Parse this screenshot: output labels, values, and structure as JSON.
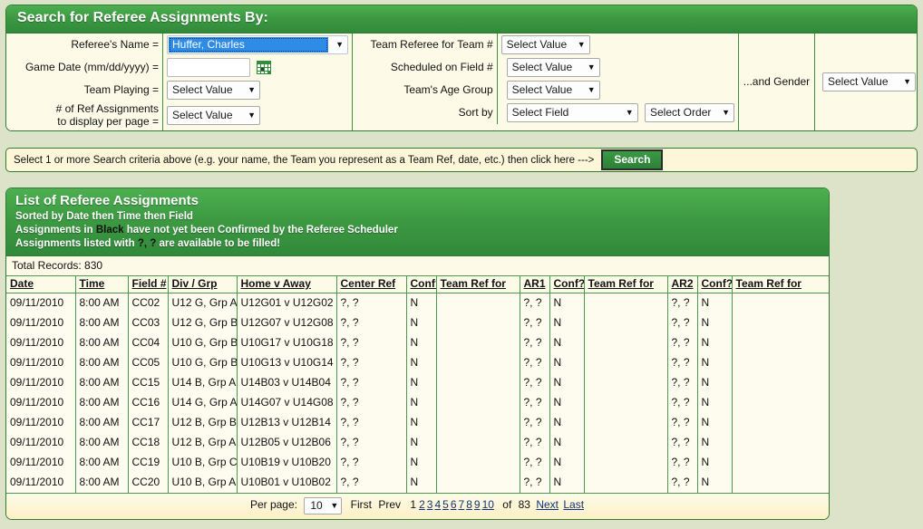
{
  "search_panel": {
    "title": "Search for Referee Assignments By:",
    "left_column": {
      "rows": [
        {
          "label": "Referee's Name =",
          "control": "select-name",
          "value": "Huffer, Charles"
        },
        {
          "label": "Game Date (mm/dd/yyyy) =",
          "control": "text-date",
          "value": "",
          "icon": "calendar-icon"
        },
        {
          "label": "Team Playing =",
          "control": "select",
          "value": "Select Value"
        },
        {
          "label": "# of Ref Assignments\nto display per page =",
          "label_line1": "# of Ref Assignments",
          "label_line2": "to display per page =",
          "control": "select",
          "value": "Select Value"
        }
      ]
    },
    "middle_column": {
      "rows": [
        {
          "label": "Team Referee for Team #",
          "control": "select",
          "value": "Select Value"
        },
        {
          "label": "Scheduled on Field #",
          "control": "select",
          "value": "Select Value"
        },
        {
          "label": "Team's Age Group",
          "control": "select",
          "value": "Select Value"
        },
        {
          "label": "Sort by",
          "control": "select2",
          "value": "Select Field",
          "value2": "Select Order"
        }
      ]
    },
    "gender_column": {
      "label": "...and Gender",
      "value": "Select Value"
    }
  },
  "hint_bar": {
    "text": "Select 1 or more Search criteria above (e.g. your name, the Team you represent as a Team Ref, date, etc.) then click here --->",
    "button": "Search"
  },
  "list_panel": {
    "title": "List of Referee Assignments",
    "sub1": "Sorted by Date then Time then Field",
    "sub2_a": "Assignments in ",
    "sub2_kw": "Black",
    "sub2_b": " have not yet been Confirmed by the Referee Scheduler",
    "sub3_a": "Assignments listed with ",
    "sub3_kw": "?, ?",
    "sub3_b": " are available to be filled!",
    "total_records": "Total Records: 830",
    "columns": [
      "Date",
      "Time",
      "Field #",
      "Div / Grp",
      "Home v Away",
      "Center Ref",
      "Conf?",
      "Team Ref for",
      "AR1",
      "Conf?",
      "Team Ref for",
      "AR2",
      "Conf?",
      "Team Ref for"
    ],
    "rows": [
      [
        "09/11/2010",
        "8:00 AM",
        "CC02",
        "U12 G, Grp A",
        "U12G01 v U12G02",
        "?, ?",
        "N",
        "",
        "?, ?",
        "N",
        "",
        "?, ?",
        "N",
        ""
      ],
      [
        "09/11/2010",
        "8:00 AM",
        "CC03",
        "U12 G, Grp B",
        "U12G07 v U12G08",
        "?, ?",
        "N",
        "",
        "?, ?",
        "N",
        "",
        "?, ?",
        "N",
        ""
      ],
      [
        "09/11/2010",
        "8:00 AM",
        "CC04",
        "U10 G, Grp B",
        "U10G17 v U10G18",
        "?, ?",
        "N",
        "",
        "?, ?",
        "N",
        "",
        "?, ?",
        "N",
        ""
      ],
      [
        "09/11/2010",
        "8:00 AM",
        "CC05",
        "U10 G, Grp B",
        "U10G13 v U10G14",
        "?, ?",
        "N",
        "",
        "?, ?",
        "N",
        "",
        "?, ?",
        "N",
        ""
      ],
      [
        "09/11/2010",
        "8:00 AM",
        "CC15",
        "U14 B, Grp A",
        "U14B03 v U14B04",
        "?, ?",
        "N",
        "",
        "?, ?",
        "N",
        "",
        "?, ?",
        "N",
        ""
      ],
      [
        "09/11/2010",
        "8:00 AM",
        "CC16",
        "U14 G, Grp A",
        "U14G07 v U14G08",
        "?, ?",
        "N",
        "",
        "?, ?",
        "N",
        "",
        "?, ?",
        "N",
        ""
      ],
      [
        "09/11/2010",
        "8:00 AM",
        "CC17",
        "U12 B, Grp B",
        "U12B13 v U12B14",
        "?, ?",
        "N",
        "",
        "?, ?",
        "N",
        "",
        "?, ?",
        "N",
        ""
      ],
      [
        "09/11/2010",
        "8:00 AM",
        "CC18",
        "U12 B, Grp A",
        "U12B05 v U12B06",
        "?, ?",
        "N",
        "",
        "?, ?",
        "N",
        "",
        "?, ?",
        "N",
        ""
      ],
      [
        "09/11/2010",
        "8:00 AM",
        "CC19",
        "U10 B, Grp C",
        "U10B19 v U10B20",
        "?, ?",
        "N",
        "",
        "?, ?",
        "N",
        "",
        "?, ?",
        "N",
        ""
      ],
      [
        "09/11/2010",
        "8:00 AM",
        "CC20",
        "U10 B, Grp A",
        "U10B01 v U10B02",
        "?, ?",
        "N",
        "",
        "?, ?",
        "N",
        "",
        "?, ?",
        "N",
        ""
      ]
    ],
    "pager": {
      "per_page_label": "Per page:",
      "per_page_value": "10",
      "first": "First",
      "prev": "Prev",
      "current_page": "1",
      "pages": [
        "2",
        "3",
        "4",
        "5",
        "6",
        "7",
        "8",
        "9",
        "10"
      ],
      "of_label": "of",
      "total_pages": "83",
      "next": "Next",
      "last": "Last"
    }
  },
  "colors": {
    "page_bg": "#dde3c8",
    "panel_bg": "#fdfbe8",
    "header_green": "#3d9a42",
    "border_green": "#2f7d32",
    "link_blue": "#13317a",
    "select_highlight": "#2e8ce6"
  }
}
